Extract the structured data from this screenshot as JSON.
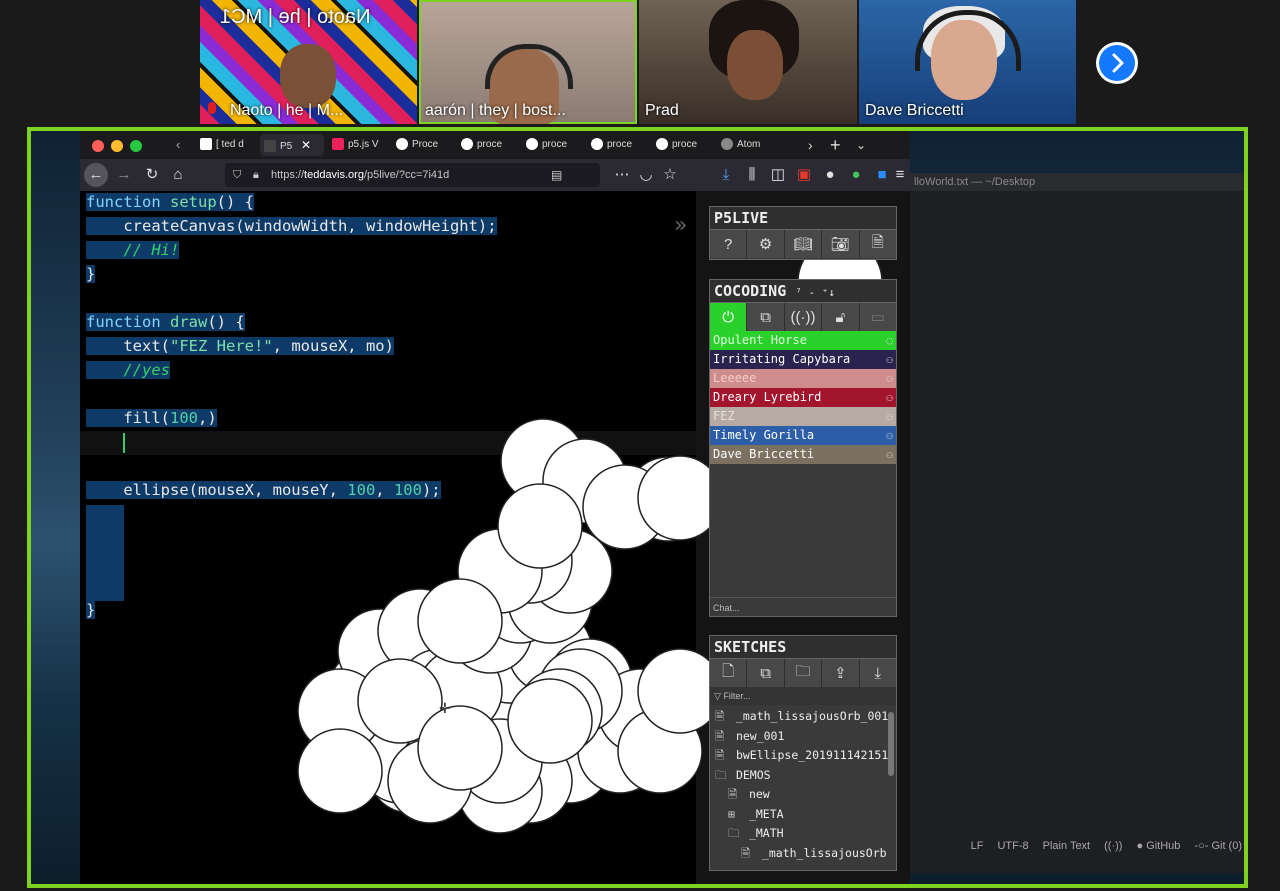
{
  "participants": [
    {
      "name": "Naoto | he | M...",
      "mirrored_text": "Naoto | he | MC1"
    },
    {
      "name": "aarón | they | bost..."
    },
    {
      "name": "Prad"
    },
    {
      "name": "Dave Briccetti"
    }
  ],
  "next_icon": "chevron-right-icon",
  "browser": {
    "tabs": [
      "[ ted d",
      "P5",
      "p5.js V",
      "Proce",
      "proce",
      "proce",
      "proce",
      "proce",
      "Atom"
    ],
    "url_prefix": "https://",
    "url_domain": "teddavis.org",
    "url_path": "/p5live/?cc=7i41d"
  },
  "code": {
    "l1a": "function",
    "l1b": "setup",
    "l1c": "() {",
    "l2": "    createCanvas(windowWidth, windowHeight);",
    "l3": "    // Hi!",
    "l4": "}",
    "l5a": "function",
    "l5b": "draw",
    "l5c": "() {",
    "l6a": "    text(",
    "l6b": "\"FEZ Here!\"",
    "l6c": ", mouseX, mo)",
    "l7": "    //yes",
    "l8a": "    fill(",
    "l8b": "100",
    "l8c": ",)",
    "l9a": "    ellipse(mouseX, mouseY, ",
    "l9b": "100",
    "l9c": ", ",
    "l9d": "100",
    "l9e": ");",
    "l10": "}",
    "collapse": "»"
  },
  "p5live": {
    "title": "P5LIVE"
  },
  "cocoding": {
    "title": "COCODING",
    "suffix": "⁷ - ⁺↓",
    "users": [
      {
        "name": "Opulent Horse",
        "color": "#2bd12b",
        "text": "#dfffdf"
      },
      {
        "name": "Irritating Capybara",
        "color": "#2a2350",
        "text": "#ffffff"
      },
      {
        "name": "Leeeee",
        "color": "#cf8c8c",
        "text": "#f3cccc"
      },
      {
        "name": "Dreary Lyrebird",
        "color": "#a3142d",
        "text": "#ffffff"
      },
      {
        "name": "FEZ",
        "color": "#b6aaa2",
        "text": "#e6e0dc"
      },
      {
        "name": "Timely Gorilla",
        "color": "#2c5fa8",
        "text": "#ffffff"
      },
      {
        "name": "Dave Briccetti",
        "color": "#7c7061",
        "text": "#ffffff"
      }
    ],
    "chat_placeholder": "Chat..."
  },
  "sketches": {
    "title": "SKETCHES",
    "filter_placeholder": "Filter...",
    "items": [
      {
        "label": "_math_lissajousOrb_001",
        "type": "file",
        "indent": 0
      },
      {
        "label": "new_001",
        "type": "file",
        "indent": 0
      },
      {
        "label": "bwEllipse_201911142151",
        "type": "file",
        "indent": 0
      },
      {
        "label": "DEMOS",
        "type": "folder",
        "indent": 0
      },
      {
        "label": "new",
        "type": "file",
        "indent": 1
      },
      {
        "label": "_META",
        "type": "folder-plus",
        "indent": 1
      },
      {
        "label": "_MATH",
        "type": "folder",
        "indent": 1
      },
      {
        "label": "_math_lissajousOrb",
        "type": "file",
        "indent": 2
      }
    ]
  },
  "atom": {
    "title": "lloWorld.txt — ~/Desktop",
    "status": [
      "LF",
      "UTF-8",
      "Plain Text",
      "GitHub",
      "Git (0)"
    ]
  }
}
